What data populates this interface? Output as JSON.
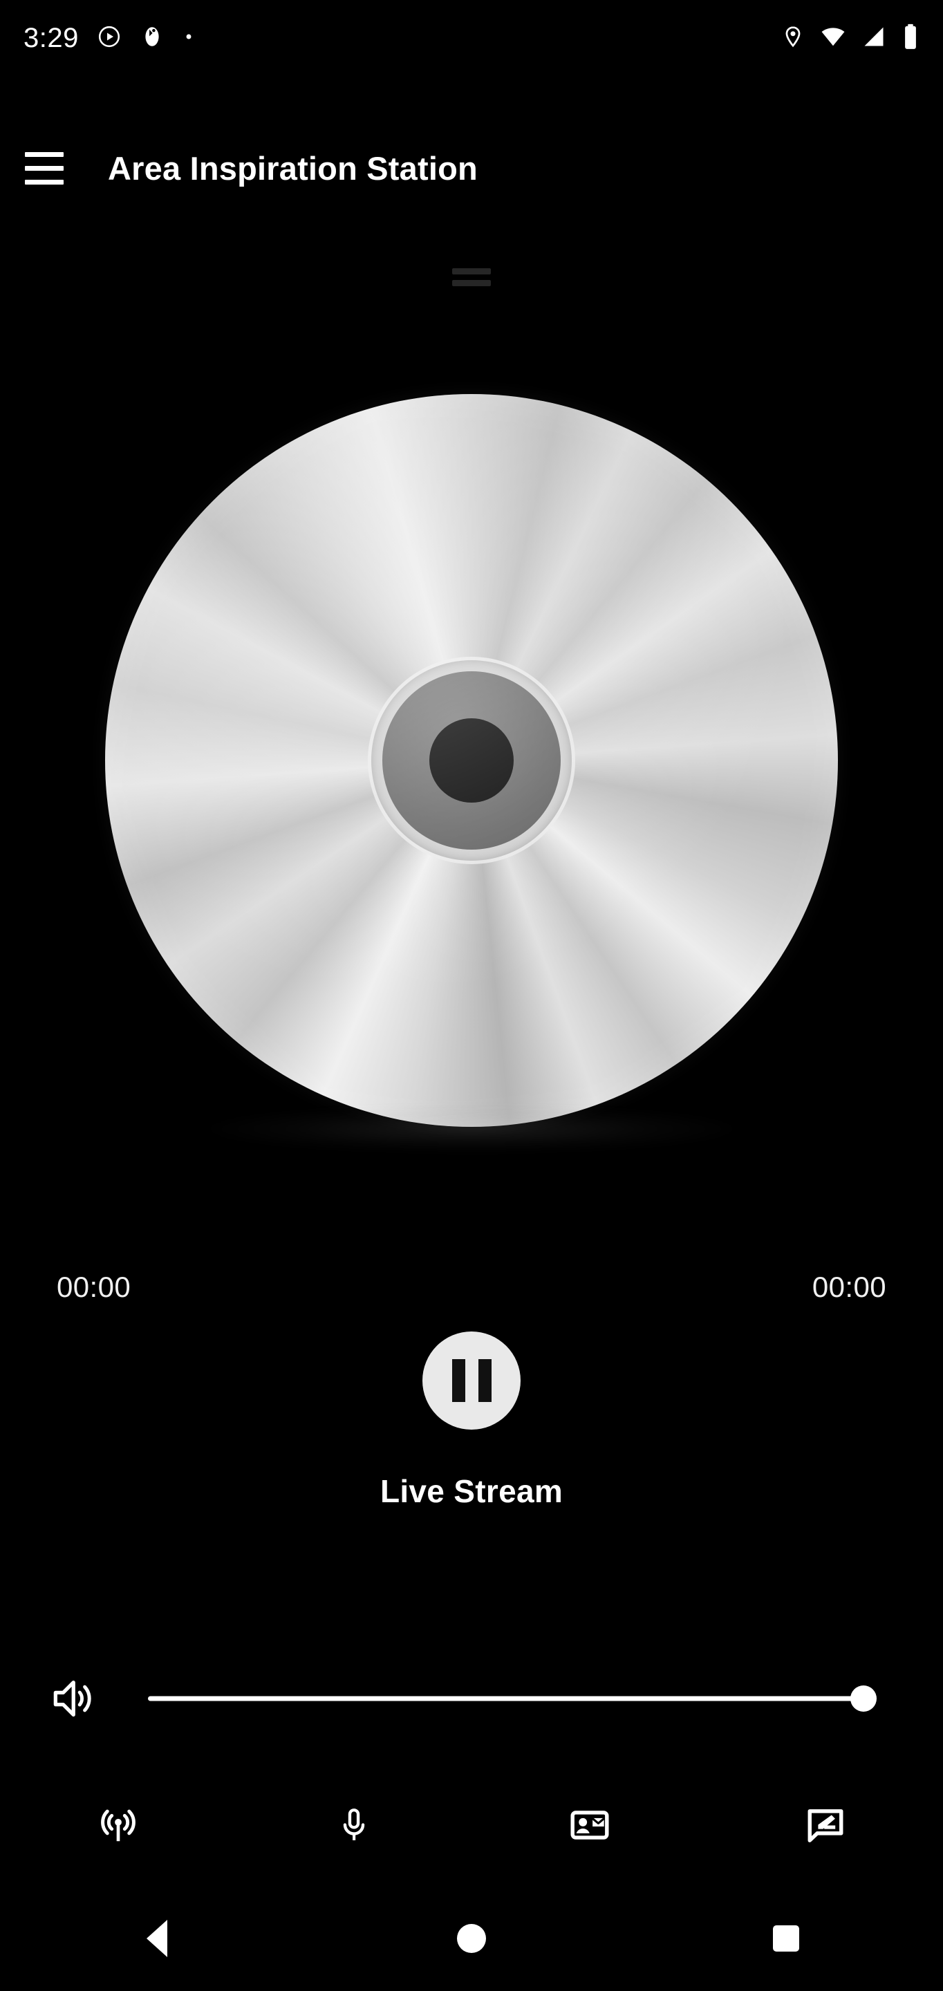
{
  "status_bar": {
    "time": "3:29",
    "left_icons": [
      {
        "name": "play-circle-icon",
        "label": "Media playing"
      },
      {
        "name": "notification-badge-icon",
        "label": "App notification"
      },
      {
        "name": "notification-dot-icon",
        "label": "Notification dot"
      }
    ],
    "right_icons": [
      {
        "name": "location-pin-icon",
        "label": "Location active"
      },
      {
        "name": "wifi-icon",
        "label": "Wi-Fi signal"
      },
      {
        "name": "cell-signal-icon",
        "label": "Cellular signal"
      },
      {
        "name": "battery-icon",
        "label": "Battery full"
      }
    ]
  },
  "app_bar": {
    "menu_icon": "hamburger-menu-icon",
    "title": "Area Inspiration Station"
  },
  "player": {
    "drag_handle_name": "drag-handle",
    "album_art_name": "cd-album-art",
    "elapsed_time": "00:00",
    "remaining_time": "00:00",
    "transport_state": "playing",
    "transport_icon": "pause-icon",
    "now_playing": "Live Stream"
  },
  "volume": {
    "icon": "volume-up-icon",
    "level_percent": 100,
    "track_color": "#ffffff",
    "thumb_color": "#ffffff"
  },
  "bottom_icons": [
    {
      "name": "broadcast-icon",
      "label": "Broadcast"
    },
    {
      "name": "microphone-icon",
      "label": "Microphone"
    },
    {
      "name": "contact-card-icon",
      "label": "Contact"
    },
    {
      "name": "compose-message-icon",
      "label": "Message"
    }
  ],
  "nav_bar": [
    {
      "name": "nav-back-button",
      "label": "Back"
    },
    {
      "name": "nav-home-button",
      "label": "Home"
    },
    {
      "name": "nav-recents-button",
      "label": "Recents"
    }
  ],
  "colors": {
    "background": "#000000",
    "text_primary": "#ffffff",
    "button_surface": "#e9e9e9",
    "drag_handle": "#262626"
  }
}
